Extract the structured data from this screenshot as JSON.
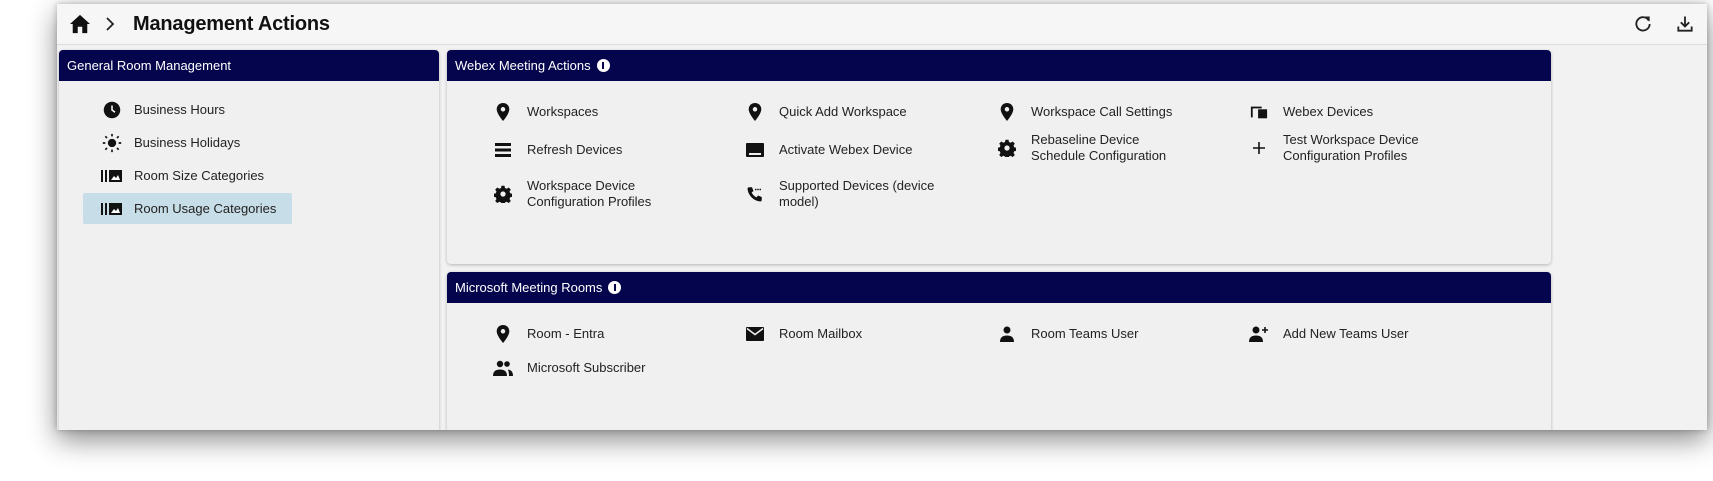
{
  "header": {
    "title": "Management Actions",
    "home_icon": "home-icon",
    "refresh_icon": "refresh-icon",
    "download_icon": "download-icon"
  },
  "general": {
    "title": "General Room Management",
    "items": [
      {
        "label": "Business Hours",
        "icon": "clock-icon"
      },
      {
        "label": "Business Holidays",
        "icon": "sun-icon"
      },
      {
        "label": "Room Size Categories",
        "icon": "category-icon"
      },
      {
        "label": "Room Usage Categories",
        "icon": "category-icon",
        "selected": true
      }
    ]
  },
  "webex": {
    "title": "Webex Meeting Actions",
    "items": [
      {
        "label": "Workspaces",
        "icon": "location-pin-icon"
      },
      {
        "label": "Quick Add Workspace",
        "icon": "location-pin-icon"
      },
      {
        "label": "Workspace Call Settings",
        "icon": "location-pin-icon"
      },
      {
        "label": "Webex Devices",
        "icon": "devices-icon"
      },
      {
        "label": "Refresh Devices",
        "icon": "list-icon"
      },
      {
        "label": "Activate Webex Device",
        "icon": "keyboard-icon"
      },
      {
        "label": "Rebaseline Device Schedule Configuration",
        "icon": "gear-icon"
      },
      {
        "label": "Test Workspace Device Configuration Profiles",
        "icon": "plus-icon"
      },
      {
        "label": "Workspace Device Configuration Profiles",
        "icon": "gear-icon"
      },
      {
        "label": "Supported Devices (device model)",
        "icon": "phone-icon"
      }
    ]
  },
  "microsoft": {
    "title": "Microsoft Meeting Rooms",
    "items": [
      {
        "label": "Room - Entra",
        "icon": "location-pin-icon"
      },
      {
        "label": "Room Mailbox",
        "icon": "mail-icon"
      },
      {
        "label": "Room Teams User",
        "icon": "person-icon"
      },
      {
        "label": "Add New Teams User",
        "icon": "person-add-icon"
      },
      {
        "label": "Microsoft Subscriber",
        "icon": "people-icon"
      }
    ]
  },
  "colors": {
    "header_bg": "#05054d",
    "selected_bg": "#c7dde7",
    "panel_bg": "#f0f0f0"
  }
}
